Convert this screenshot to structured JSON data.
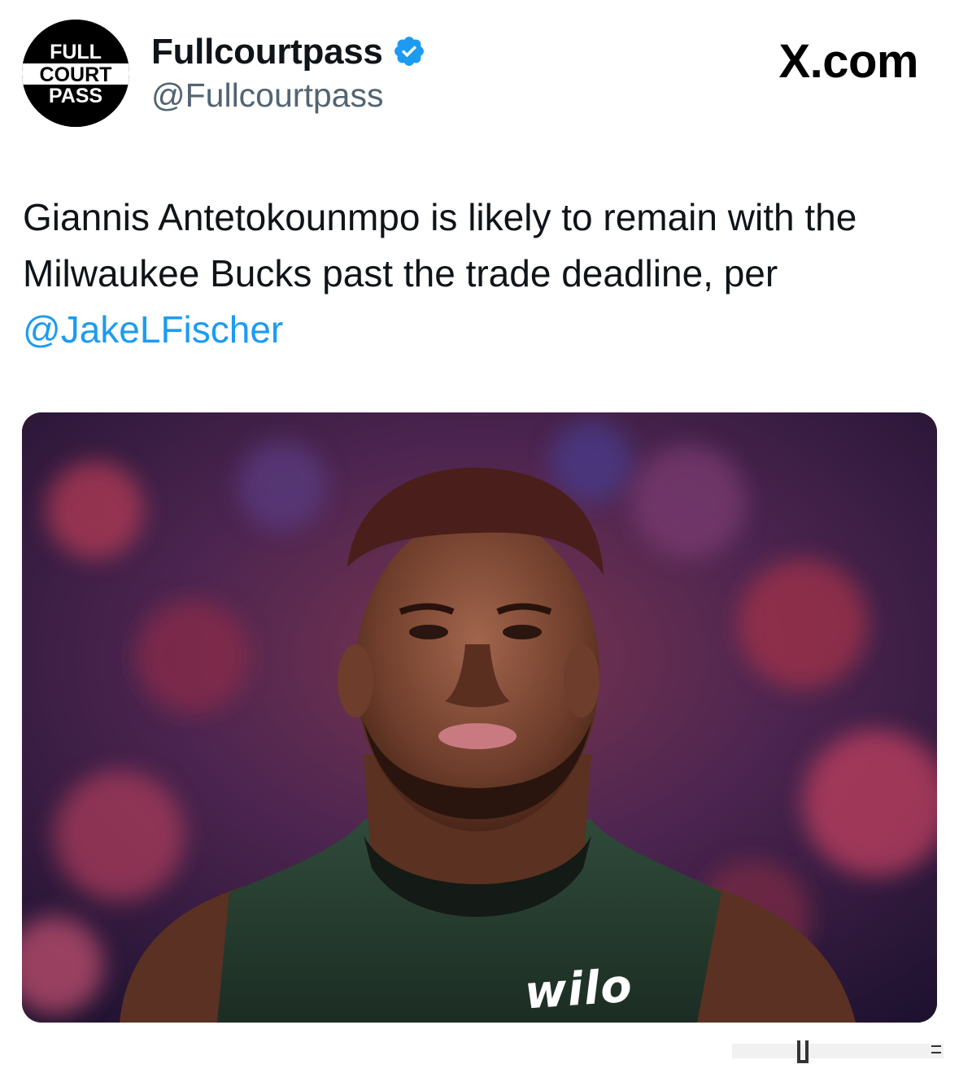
{
  "author": {
    "display_name": "Fullcourtpass",
    "handle": "@Fullcourtpass",
    "verified": true,
    "avatar_logo_text": [
      "FULL",
      "COURT",
      "PASS"
    ]
  },
  "site_label": "X.com",
  "tweet": {
    "text": "Giannis Antetokounmpo is likely to remain with the Milwaukee Bucks past the trade deadline, per ",
    "mention": "@JakeLFischer"
  },
  "media": {
    "jersey_sponsor_text": "wilo"
  },
  "colors": {
    "text_primary": "#0f1419",
    "text_secondary": "#536471",
    "mention": "#1d9bf0",
    "verified_badge": "#1d9bf0"
  },
  "icons": {
    "verified": "verified-badge-icon"
  }
}
